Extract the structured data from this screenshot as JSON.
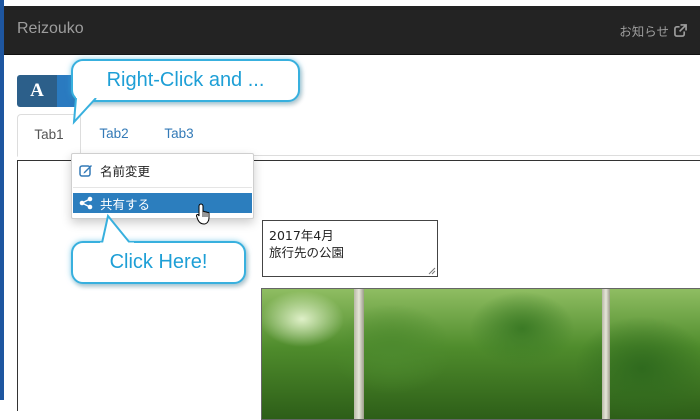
{
  "app": {
    "title": "Reizouko",
    "notice_label": "お知らせ",
    "notice_icon": "external-link-icon"
  },
  "toolbar": {
    "font_button_label": "A"
  },
  "tabs": [
    {
      "label": "Tab1",
      "active": true
    },
    {
      "label": "Tab2",
      "active": false
    },
    {
      "label": "Tab3",
      "active": false
    }
  ],
  "context_menu": {
    "items": [
      {
        "label": "名前変更",
        "icon": "edit-icon",
        "highlighted": false
      },
      {
        "label": "共有する",
        "icon": "share-icon",
        "highlighted": true
      }
    ]
  },
  "memo": {
    "lines": [
      "2017年4月",
      "旅行先の公園"
    ]
  },
  "callouts": {
    "top": "Right-Click and ...",
    "bottom": "Click Here!"
  },
  "colors": {
    "navbar": "#232323",
    "accent": "#337ab7",
    "menu_highlight": "#2c7ebe",
    "callout_border": "#38b0de",
    "callout_text": "#1e9fd6"
  }
}
